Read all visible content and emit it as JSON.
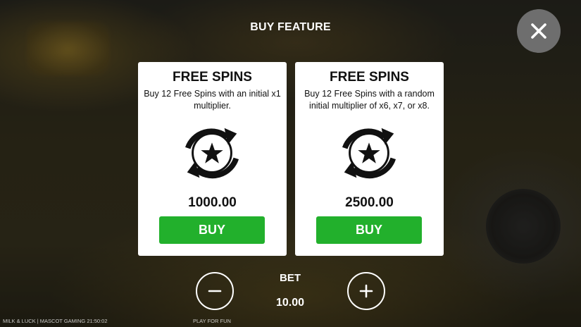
{
  "dialog": {
    "title": "BUY FEATURE"
  },
  "options": [
    {
      "title": "FREE SPINS",
      "description": "Buy 12 Free Spins with an initial x1 multiplier.",
      "price": "1000.00",
      "button_label": "BUY",
      "icon": "free-spins-star-cycle-icon"
    },
    {
      "title": "FREE SPINS",
      "description": "Buy 12 Free Spins with a random initial multiplier of x6, x7, or x8.",
      "price": "2500.00",
      "button_label": "BUY",
      "icon": "free-spins-star-cycle-icon"
    }
  ],
  "bet": {
    "label": "BET",
    "value": "10.00"
  },
  "footer": {
    "game_info": "MILK & LUCK | MASCOT GAMING  21:50:02",
    "mode": "PLAY FOR FUN"
  },
  "colors": {
    "buy_button": "#22b02c",
    "close_button": "#6e6e6e",
    "card_background": "#ffffff"
  }
}
